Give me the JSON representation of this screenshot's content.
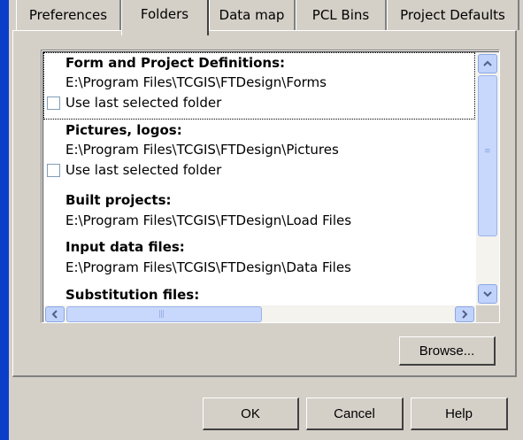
{
  "tabs": [
    {
      "label": "Preferences"
    },
    {
      "label": "Folders"
    },
    {
      "label": "Data map"
    },
    {
      "label": "PCL Bins"
    },
    {
      "label": "Project Defaults"
    }
  ],
  "folders": [
    {
      "title": "Form and Project Definitions:",
      "path": "E:\\Program Files\\TCGIS\\FTDesign\\Forms",
      "checkbox_label": "Use last selected folder",
      "checked": false
    },
    {
      "title": "Pictures, logos:",
      "path": "E:\\Program Files\\TCGIS\\FTDesign\\Pictures",
      "checkbox_label": "Use last selected folder",
      "checked": false
    },
    {
      "title": "Built projects:",
      "path": "E:\\Program Files\\TCGIS\\FTDesign\\Load Files"
    },
    {
      "title": "Input data files:",
      "path": "E:\\Program Files\\TCGIS\\FTDesign\\Data Files"
    },
    {
      "title": "Substitution files:"
    }
  ],
  "buttons": {
    "browse": "Browse...",
    "ok": "OK",
    "cancel": "Cancel",
    "help": "Help"
  }
}
